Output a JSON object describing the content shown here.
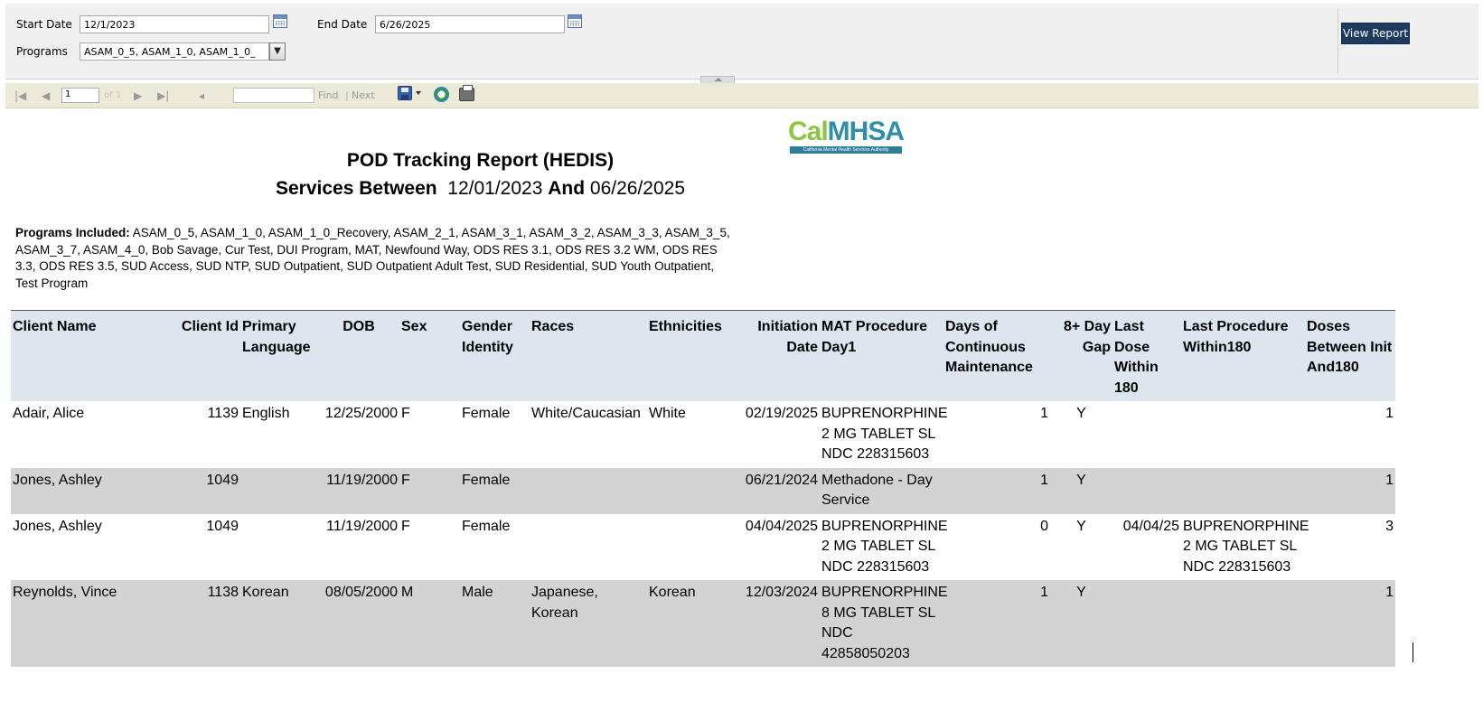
{
  "params": {
    "start_date_label": "Start Date",
    "start_date_value": "12/1/2023",
    "end_date_label": "End Date",
    "end_date_value": "6/26/2025",
    "programs_label": "Programs",
    "programs_value": "ASAM_0_5, ASAM_1_0, ASAM_1_0_",
    "view_report_label": "View Report"
  },
  "toolbar": {
    "page_value": "1",
    "page_of": "of 1",
    "find_label": "Find",
    "find_separator": "|",
    "next_label": "Next"
  },
  "report": {
    "logo": {
      "part1": "Cal",
      "part2": "MHSA",
      "subtitle": "California Mental Health Services Authority"
    },
    "title": "POD Tracking Report (HEDIS)",
    "services_between_label": "Services Between",
    "start_date": "12/01/2023",
    "and_label": "And",
    "end_date": "06/26/2025",
    "programs_included_label": "Programs Included:",
    "programs_included": "ASAM_0_5, ASAM_1_0, ASAM_1_0_Recovery, ASAM_2_1, ASAM_3_1, ASAM_3_2, ASAM_3_3, ASAM_3_5, ASAM_3_7, ASAM_4_0, Bob Savage, Cur Test, DUI Program, MAT, Newfound Way, ODS RES 3.1, ODS RES 3.2 WM, ODS RES 3.3, ODS RES 3.5, SUD Access, SUD NTP, SUD Outpatient, SUD Outpatient Adult Test, SUD Residential, SUD Youth Outpatient, Test Program"
  },
  "table": {
    "headers": [
      "Client Name",
      "Client Id",
      "Primary Language",
      "DOB",
      "Sex",
      "Gender Identity",
      "Races",
      "Ethnicities",
      "Initiation Date",
      "MAT Procedure Day1",
      "Days of Continuous Maintenance",
      "8+ Day Gap",
      "Last Dose Within 180",
      "Last Procedure Within180",
      "Doses Between Init And180"
    ],
    "rows": [
      [
        "Adair, Alice",
        "1139",
        "English",
        "12/25/2000",
        "F",
        "Female",
        "White/Caucasian",
        "White",
        "02/19/2025",
        "BUPRENORPHINE 2 MG TABLET SL NDC 228315603",
        "1",
        "Y",
        "",
        "",
        "1"
      ],
      [
        "Jones, Ashley",
        "1049",
        "",
        "11/19/2000",
        "F",
        "Female",
        "",
        "",
        "06/21/2024",
        "Methadone - Day Service",
        "1",
        "Y",
        "",
        "",
        "1"
      ],
      [
        "Jones, Ashley",
        "1049",
        "",
        "11/19/2000",
        "F",
        "Female",
        "",
        "",
        "04/04/2025",
        "BUPRENORPHINE 2 MG TABLET SL NDC 228315603",
        "0",
        "Y",
        "04/04/25",
        "BUPRENORPHINE 2 MG TABLET SL NDC 228315603",
        "3"
      ],
      [
        "Reynolds, Vince",
        "1138",
        "Korean",
        "08/05/2000",
        "M",
        "Male",
        "Japanese, Korean",
        "Korean",
        "12/03/2024",
        "BUPRENORPHINE 8 MG TABLET SL NDC 42858050203",
        "1",
        "Y",
        "",
        "",
        "1"
      ]
    ]
  },
  "colors": {
    "header_bg": "#dde6ee",
    "alt_row_bg": "#d3d3d3",
    "view_button_bg": "#1f3a5f",
    "toolbar_bg": "#ece9d8"
  }
}
